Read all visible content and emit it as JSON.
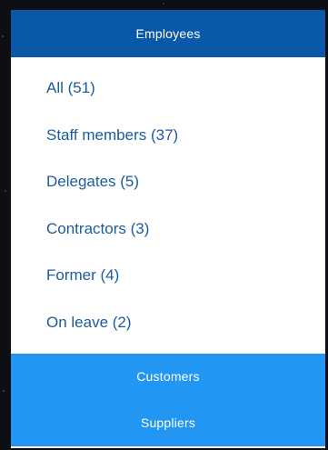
{
  "sections": {
    "employees": {
      "label": "Employees",
      "items": [
        {
          "label": "All (51)"
        },
        {
          "label": "Staff members (37)"
        },
        {
          "label": "Delegates (5)"
        },
        {
          "label": "Contractors (3)"
        },
        {
          "label": "Former (4)"
        },
        {
          "label": "On leave (2)"
        }
      ]
    },
    "customers": {
      "label": "Customers"
    },
    "suppliers": {
      "label": "Suppliers"
    }
  },
  "colors": {
    "active_header": "#0a58a8",
    "inactive_header": "#2196f3",
    "item_text": "#1b5c9e",
    "panel_bg": "#ffffff"
  }
}
